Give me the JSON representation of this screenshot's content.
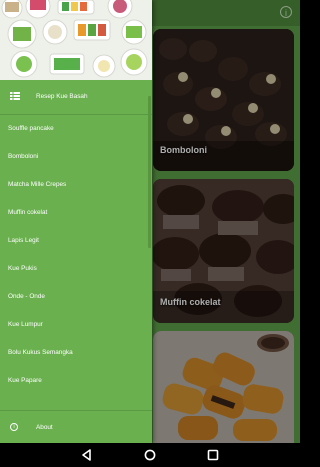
{
  "app": {
    "info_icon": "info-icon",
    "cards": [
      {
        "title": "Bomboloni"
      },
      {
        "title": "Muffin cokelat"
      },
      {
        "title": ""
      }
    ]
  },
  "drawer": {
    "header_item": {
      "label": "Resep Kue Basah",
      "icon": "grid-icon"
    },
    "items": [
      {
        "label": "Souffle pancake"
      },
      {
        "label": "Bomboloni"
      },
      {
        "label": "Matcha Mille Crepes"
      },
      {
        "label": "Muffin cokelat"
      },
      {
        "label": "Lapis Legit"
      },
      {
        "label": "Kue Pukis"
      },
      {
        "label": "Onde - Onde"
      },
      {
        "label": "Kue Lumpur"
      },
      {
        "label": "Bolu Kukus Semangka"
      },
      {
        "label": "Kue Papare"
      }
    ],
    "about": {
      "label": "About",
      "icon": "info-icon"
    }
  },
  "colors": {
    "drawer": "#6ab04f",
    "app_background": "#5fa34a",
    "toolbar": "#4e8b3c"
  },
  "system_nav": {
    "buttons": [
      "back-icon",
      "home-icon",
      "recent-apps-icon"
    ]
  }
}
